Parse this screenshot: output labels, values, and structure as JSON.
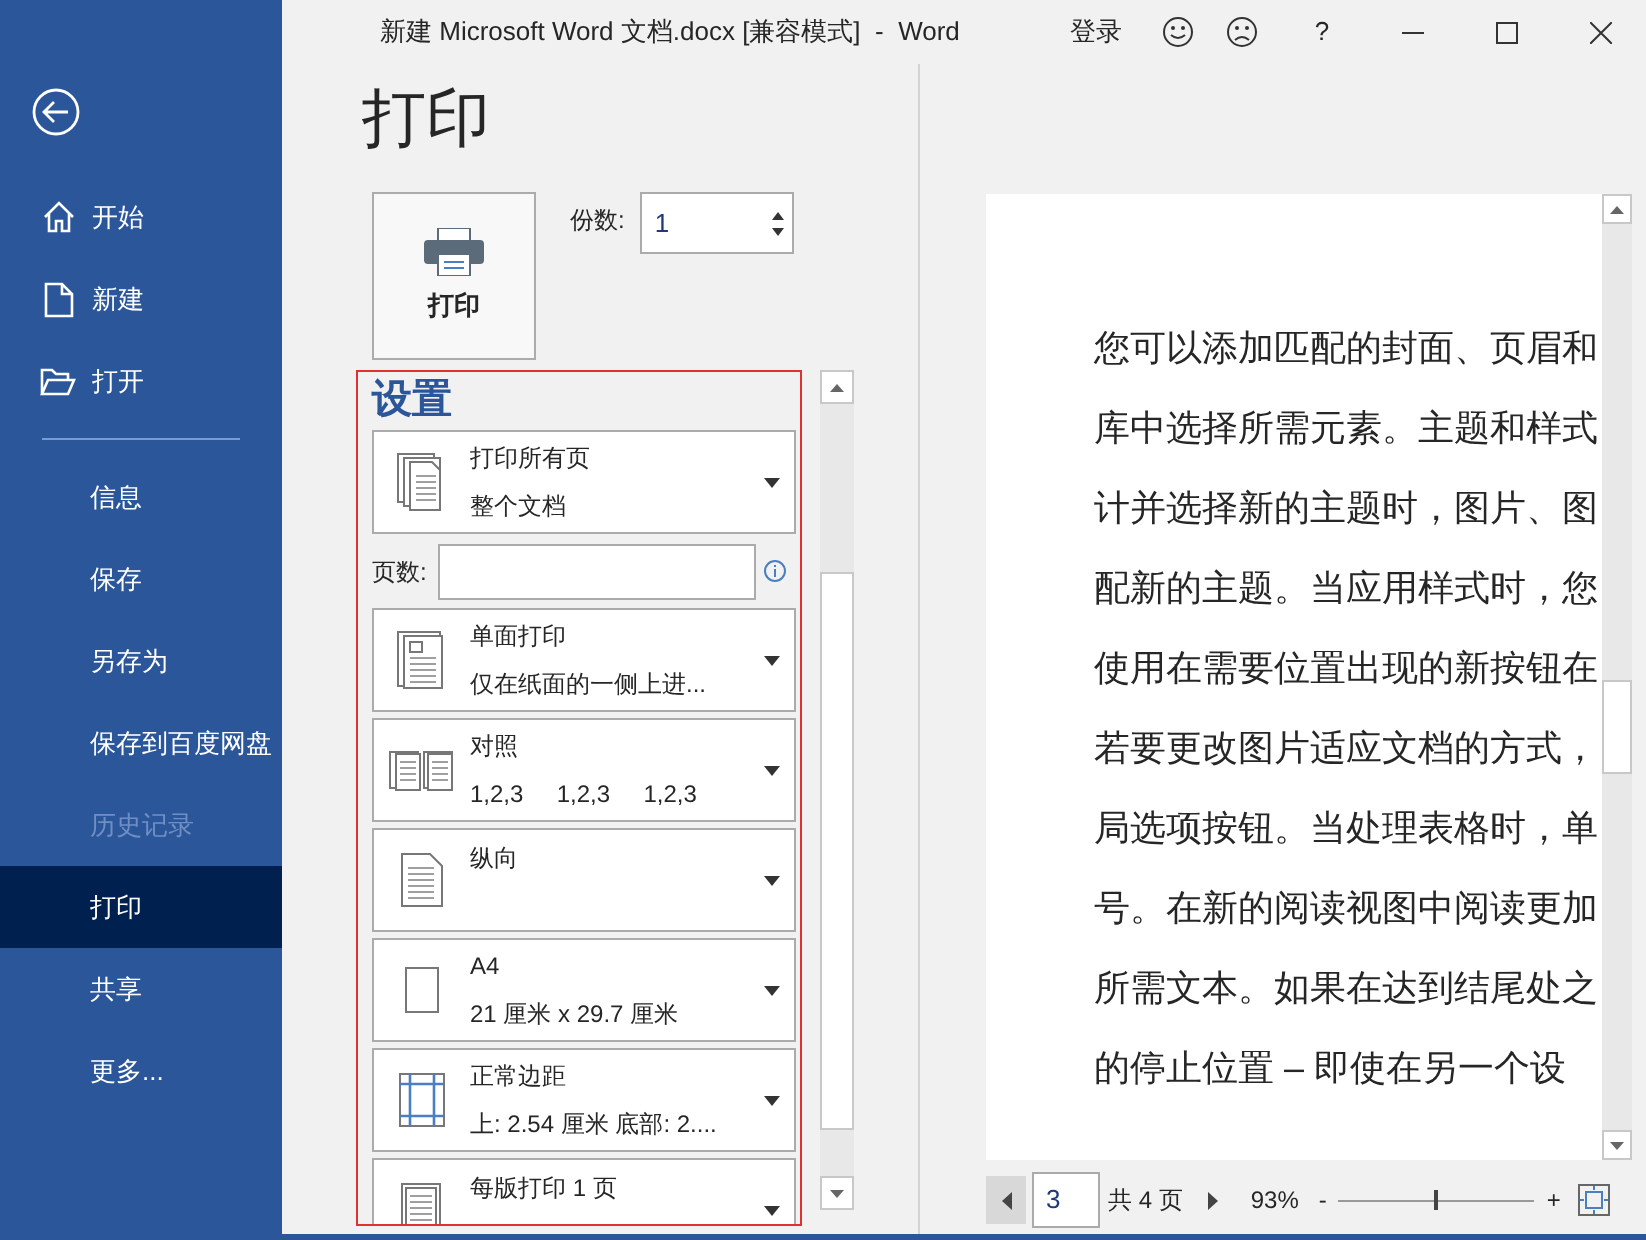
{
  "window": {
    "title": "新建 Microsoft Word 文档.docx [兼容模式]  -  Word",
    "sign_in": "登录",
    "help": "?"
  },
  "sidebar": {
    "top_items": [
      {
        "label": "开始",
        "kind": "home"
      },
      {
        "label": "新建",
        "kind": "new"
      },
      {
        "label": "打开",
        "kind": "open"
      }
    ],
    "items": [
      {
        "label": "信息",
        "selected": false,
        "disabled": false
      },
      {
        "label": "保存",
        "selected": false,
        "disabled": false
      },
      {
        "label": "另存为",
        "selected": false,
        "disabled": false
      },
      {
        "label": "保存到百度网盘",
        "selected": false,
        "disabled": false
      },
      {
        "label": "历史记录",
        "selected": false,
        "disabled": true
      },
      {
        "label": "打印",
        "selected": true,
        "disabled": false
      },
      {
        "label": "共享",
        "selected": false,
        "disabled": false
      },
      {
        "label": "更多...",
        "selected": false,
        "disabled": false
      }
    ]
  },
  "page_title": "打印",
  "print_button": {
    "label": "打印"
  },
  "copies": {
    "label": "份数:",
    "value": "1"
  },
  "settings": {
    "title": "设置",
    "items": [
      {
        "kind": "pages",
        "line1": "打印所有页",
        "line2": "整个文档"
      },
      {
        "kind": "field",
        "label": "页数:"
      },
      {
        "kind": "sides",
        "line1": "单面打印",
        "line2": "仅在纸面的一侧上进..."
      },
      {
        "kind": "collate",
        "line1": "对照",
        "line2": "1,2,3     1,2,3     1,2,3"
      },
      {
        "kind": "orientation",
        "line1": "纵向"
      },
      {
        "kind": "paper",
        "line1": "A4",
        "line2": "21 厘米 x 29.7 厘米"
      },
      {
        "kind": "margins",
        "line1": "正常边距",
        "line2": "上: 2.54 厘米 底部: 2...."
      },
      {
        "kind": "per_sheet",
        "line1": "每版打印 1 页"
      }
    ]
  },
  "preview": {
    "lines": [
      "您可以添加匹配的封面、页眉和",
      "库中选择所需元素。主题和样式",
      "计并选择新的主题时，图片、图",
      "配新的主题。当应用样式时，您",
      "使用在需要位置出现的新按钮在",
      "若要更改图片适应文档的方式，",
      "局选项按钮。当处理表格时，单",
      "号。在新的阅读视图中阅读更加",
      "所需文本。如果在达到结尾处之",
      "的停止位置 – 即使在另一个设"
    ]
  },
  "status_bar": {
    "page": "3",
    "total": "共 4 页",
    "zoom": "93%",
    "zoom_out": "-",
    "zoom_in": "+",
    "zoom_slider": {
      "level": 0.5
    }
  }
}
